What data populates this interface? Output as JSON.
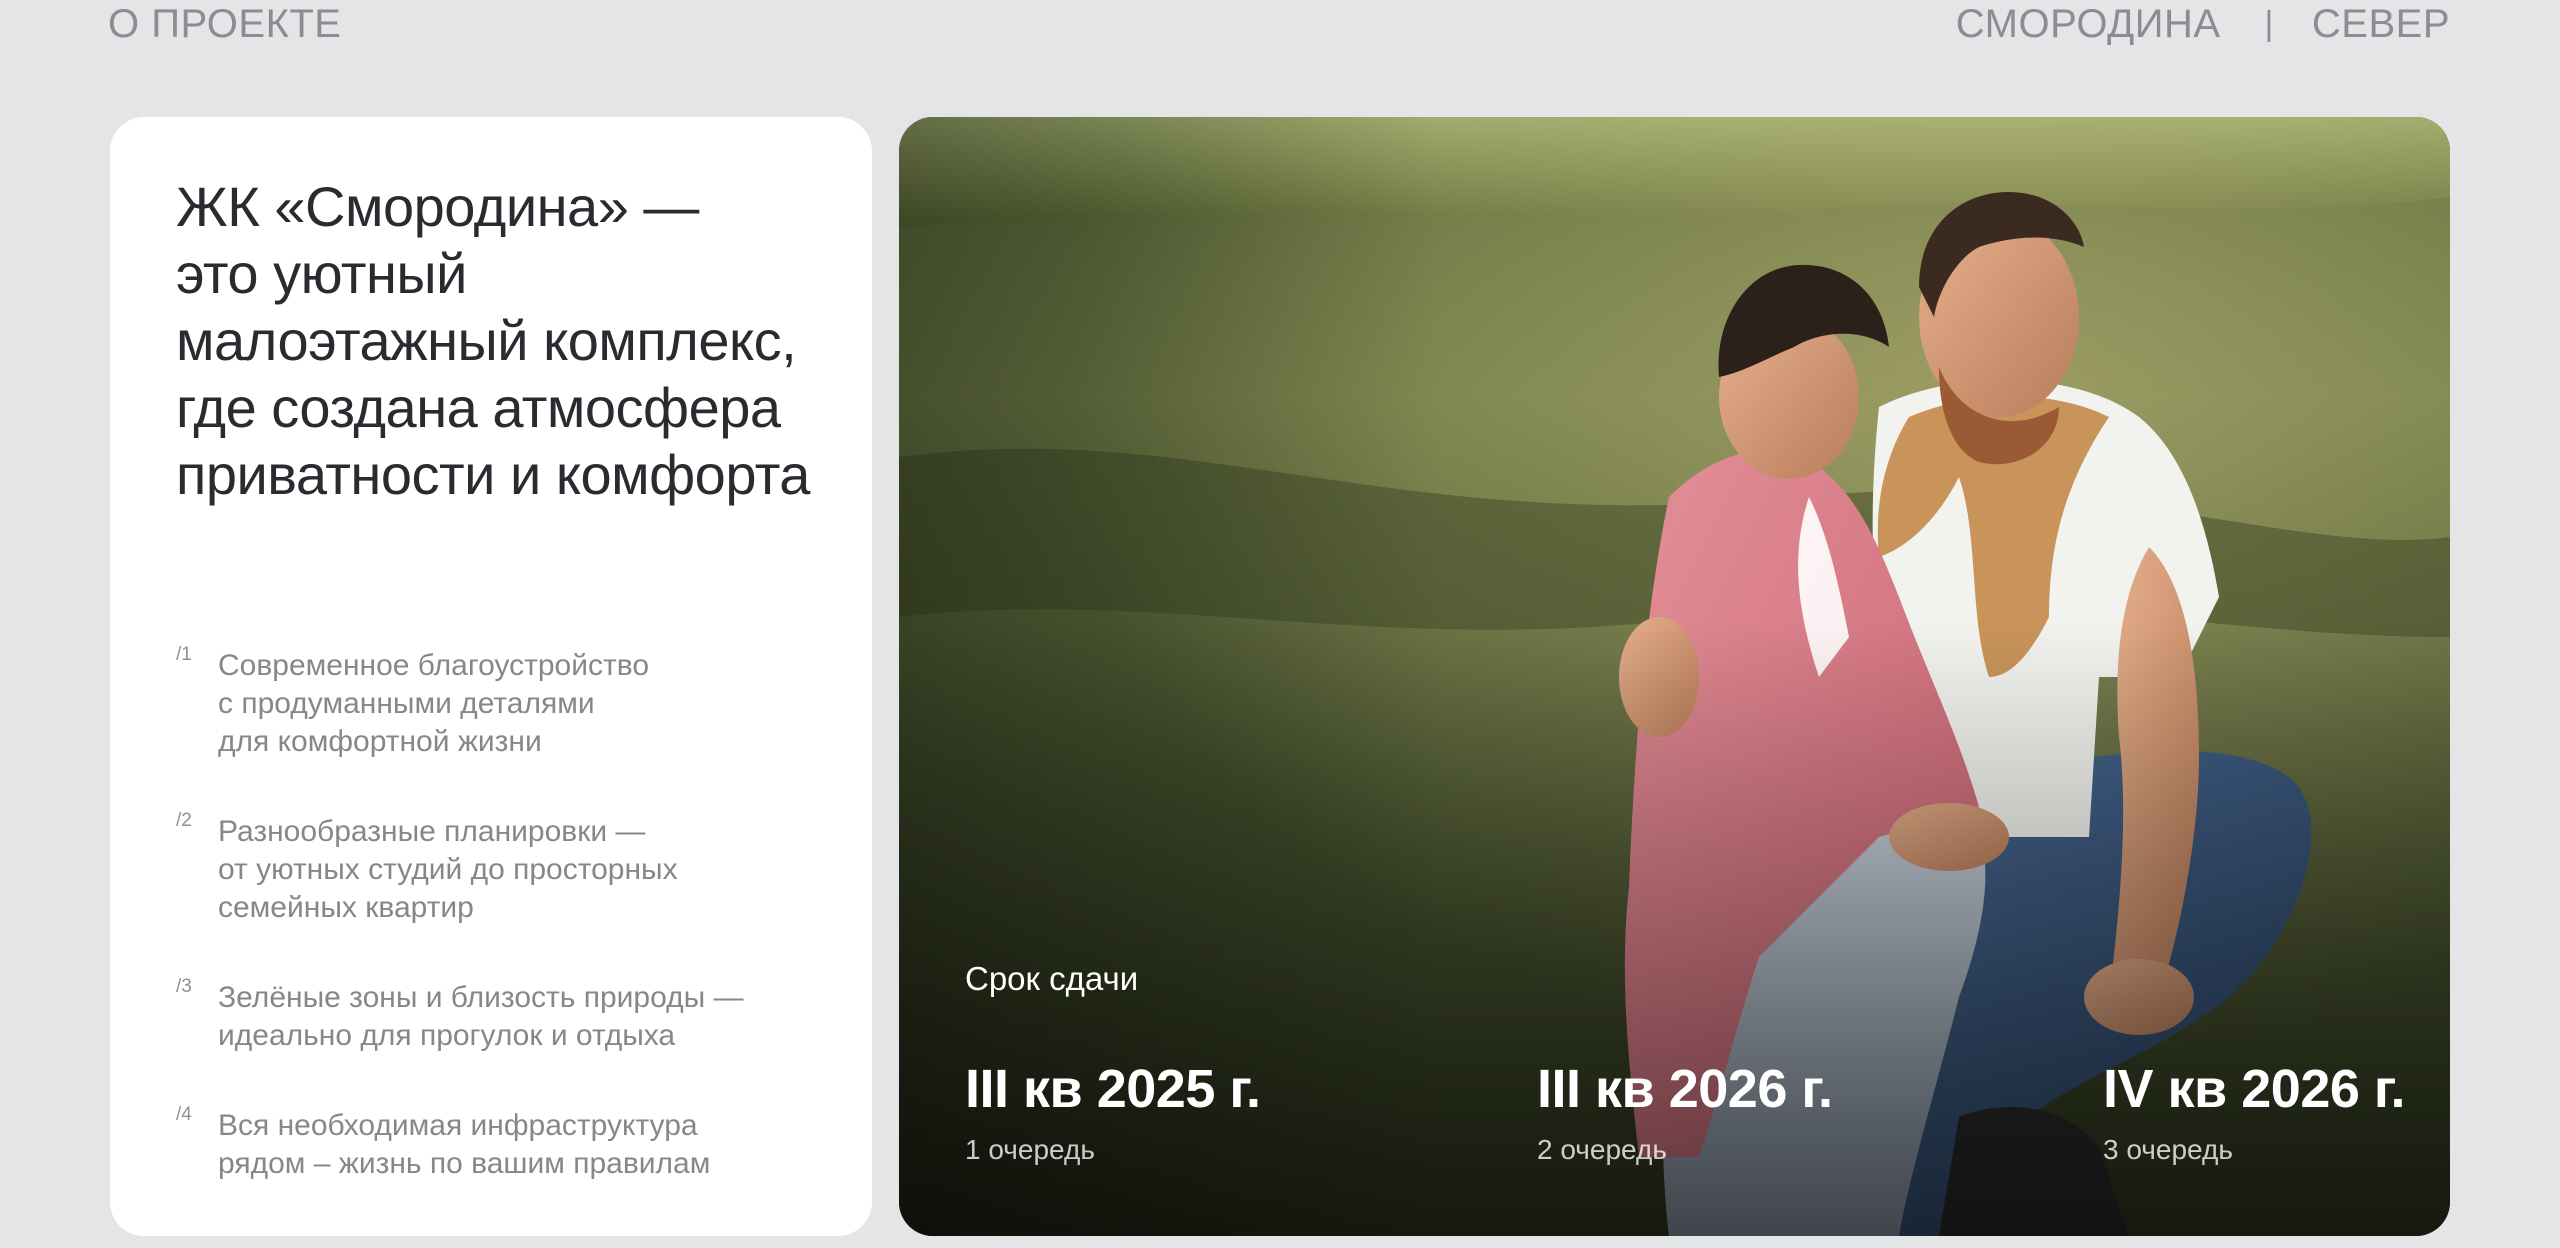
{
  "topbar": {
    "section_label": "О ПРОЕКТЕ",
    "nav": {
      "project_1": "СМОРОДИНА",
      "separator": "|",
      "project_2": "СЕВЕР"
    }
  },
  "intro": {
    "headline": "ЖК «Смородина» — это уютный малоэтажный комплекс, где создана атмосфера приватности и комфорта",
    "headline_lines": [
      "ЖК «Смородина» —",
      "это уютный",
      "малоэтажный комплекс,",
      "где создана атмосфера",
      "приватности и комфорта"
    ]
  },
  "features": [
    {
      "num": "/1",
      "text": "Современное благоустройство\nс продуманными деталями\nдля комфортной жизни"
    },
    {
      "num": "/2",
      "text": "Разнообразные планировки —\nот уютных студий до просторных\nсемейных квартир"
    },
    {
      "num": "/3",
      "text": "Зелёные зоны и близость природы —\nидеально для прогулок и отдыха"
    },
    {
      "num": "/4",
      "text": "Вся необходимая инфраструктура\nрядом – жизнь по вашим правилам"
    }
  ],
  "delivery": {
    "caption": "Срок сдачи",
    "stages": [
      {
        "date": "III кв 2025 г.",
        "phase": "1 очередь"
      },
      {
        "date": "III кв 2026 г.",
        "phase": "2 очередь"
      },
      {
        "date": "IV кв 2026 г.",
        "phase": "3 очередь"
      }
    ]
  },
  "colors": {
    "page_bg": "#e4e5e7",
    "card_bg": "#ffffff",
    "heading_text": "#2a2b30",
    "muted_text": "#86878c",
    "overlay_text": "#ffffff"
  },
  "icons": []
}
